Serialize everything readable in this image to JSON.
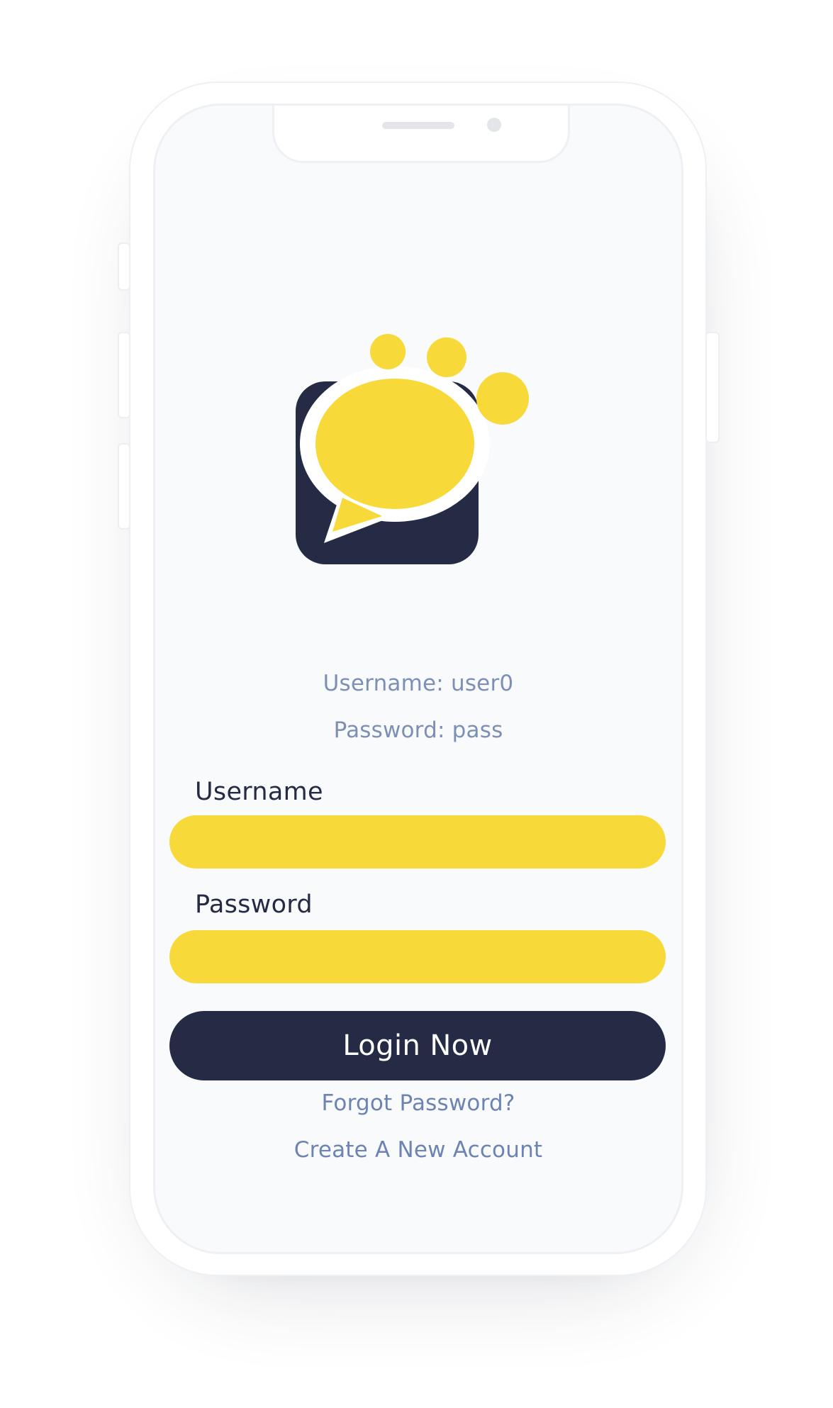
{
  "login": {
    "hint_username": "Username: user0",
    "hint_password": "Password: pass",
    "username_label": "Username",
    "username_value": "",
    "password_label": "Password",
    "password_value": "",
    "login_button": "Login Now",
    "forgot_link": "Forgot Password?",
    "create_link": "Create A New Account"
  },
  "colors": {
    "accent_yellow": "#f7da3a",
    "navy": "#252b45",
    "link_blue": "#6d84b3",
    "screen_bg": "#f9fafc"
  },
  "icons": {
    "logo": "paw-chat-bubble-logo"
  }
}
